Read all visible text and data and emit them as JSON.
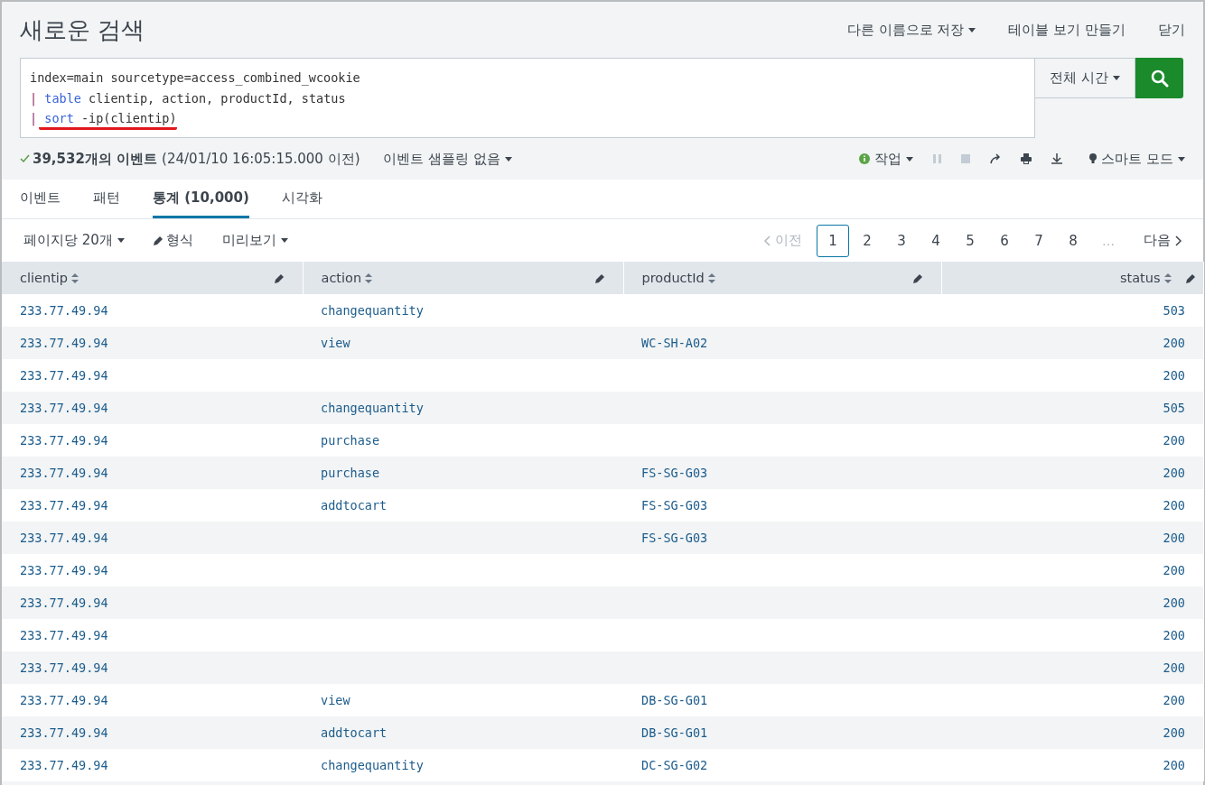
{
  "title": "새로운 검색",
  "header_actions": [
    {
      "label": "다른 이름으로 저장",
      "dropdown": true
    },
    {
      "label": "테이블 보기 만들기",
      "dropdown": false
    },
    {
      "label": "닫기",
      "dropdown": false
    }
  ],
  "search": {
    "lines": [
      {
        "underlined": false,
        "tokens": [
          {
            "kind": "plain",
            "text": "index=main sourcetype=access_combined_wcookie"
          }
        ]
      },
      {
        "underlined": false,
        "tokens": [
          {
            "kind": "pipe",
            "text": "|"
          },
          {
            "kind": "command",
            "text": "table"
          },
          {
            "kind": "plain",
            "text": "clientip, action, productId, status"
          }
        ]
      },
      {
        "underlined": true,
        "tokens": [
          {
            "kind": "pipe",
            "text": "|"
          },
          {
            "kind": "command",
            "text": "sort"
          },
          {
            "kind": "plain",
            "text": "-ip(clientip)"
          }
        ]
      }
    ],
    "time_picker": "전체 시간"
  },
  "status": {
    "count": "39,532개의 이벤트",
    "detail": "(24/01/10 16:05:15.000 이전)",
    "sampling": "이벤트 샘플링 없음",
    "job": "작업",
    "mode": "스마트 모드"
  },
  "tabs": [
    {
      "label": "이벤트",
      "selected": false
    },
    {
      "label": "패턴",
      "selected": false
    },
    {
      "label": "통계 (10,000)",
      "selected": true
    },
    {
      "label": "시각화",
      "selected": false
    }
  ],
  "toolbar": {
    "per_page": "페이지당 20개",
    "format": "형식",
    "preview": "미리보기"
  },
  "pagination": {
    "prev": {
      "label": "이전",
      "disabled": true
    },
    "pages": [
      {
        "label": "1",
        "selected": true
      },
      {
        "label": "2",
        "selected": false
      },
      {
        "label": "3",
        "selected": false
      },
      {
        "label": "4",
        "selected": false
      },
      {
        "label": "5",
        "selected": false
      },
      {
        "label": "6",
        "selected": false
      },
      {
        "label": "7",
        "selected": false
      },
      {
        "label": "8",
        "selected": false
      }
    ],
    "ellipsis": "…",
    "next": {
      "label": "다음",
      "disabled": false
    }
  },
  "table": {
    "columns": [
      {
        "label": "clientip"
      },
      {
        "label": "action"
      },
      {
        "label": "productId"
      },
      {
        "label": "status"
      }
    ],
    "rows": [
      [
        "233.77.49.94",
        "changequantity",
        "",
        "503"
      ],
      [
        "233.77.49.94",
        "view",
        "WC-SH-A02",
        "200"
      ],
      [
        "233.77.49.94",
        "",
        "",
        "200"
      ],
      [
        "233.77.49.94",
        "changequantity",
        "",
        "505"
      ],
      [
        "233.77.49.94",
        "purchase",
        "",
        "200"
      ],
      [
        "233.77.49.94",
        "purchase",
        "FS-SG-G03",
        "200"
      ],
      [
        "233.77.49.94",
        "addtocart",
        "FS-SG-G03",
        "200"
      ],
      [
        "233.77.49.94",
        "",
        "FS-SG-G03",
        "200"
      ],
      [
        "233.77.49.94",
        "",
        "",
        "200"
      ],
      [
        "233.77.49.94",
        "",
        "",
        "200"
      ],
      [
        "233.77.49.94",
        "",
        "",
        "200"
      ],
      [
        "233.77.49.94",
        "",
        "",
        "200"
      ],
      [
        "233.77.49.94",
        "view",
        "DB-SG-G01",
        "200"
      ],
      [
        "233.77.49.94",
        "addtocart",
        "DB-SG-G01",
        "200"
      ],
      [
        "233.77.49.94",
        "changequantity",
        "DC-SG-G02",
        "200"
      ]
    ]
  }
}
